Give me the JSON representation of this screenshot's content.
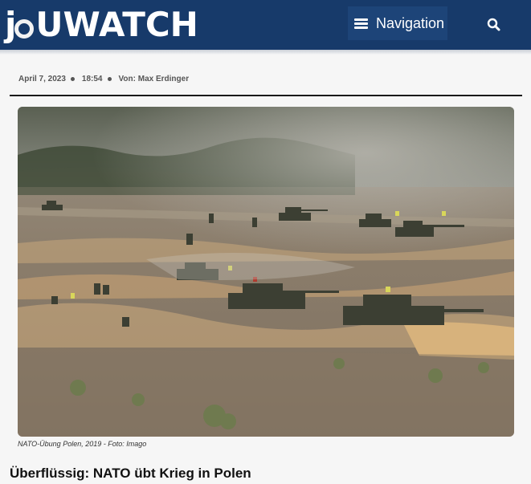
{
  "header": {
    "logo_prefix": "j",
    "logo_suffix": "uwatch",
    "nav_label": "Navigation"
  },
  "article": {
    "date": "April 7, 2023",
    "time": "18:54",
    "author": "Von: Max Erdinger",
    "image_caption": "NATO-Übung Polen, 2019 - Foto: Imago",
    "headline": "Überflüssig: NATO übt Krieg in Polen"
  },
  "colors": {
    "header_bg": "#173a6a",
    "nav_button_bg": "#1d4478",
    "page_bg": "#f6f6f6"
  },
  "icons": [
    "hamburger-icon",
    "search-icon"
  ]
}
